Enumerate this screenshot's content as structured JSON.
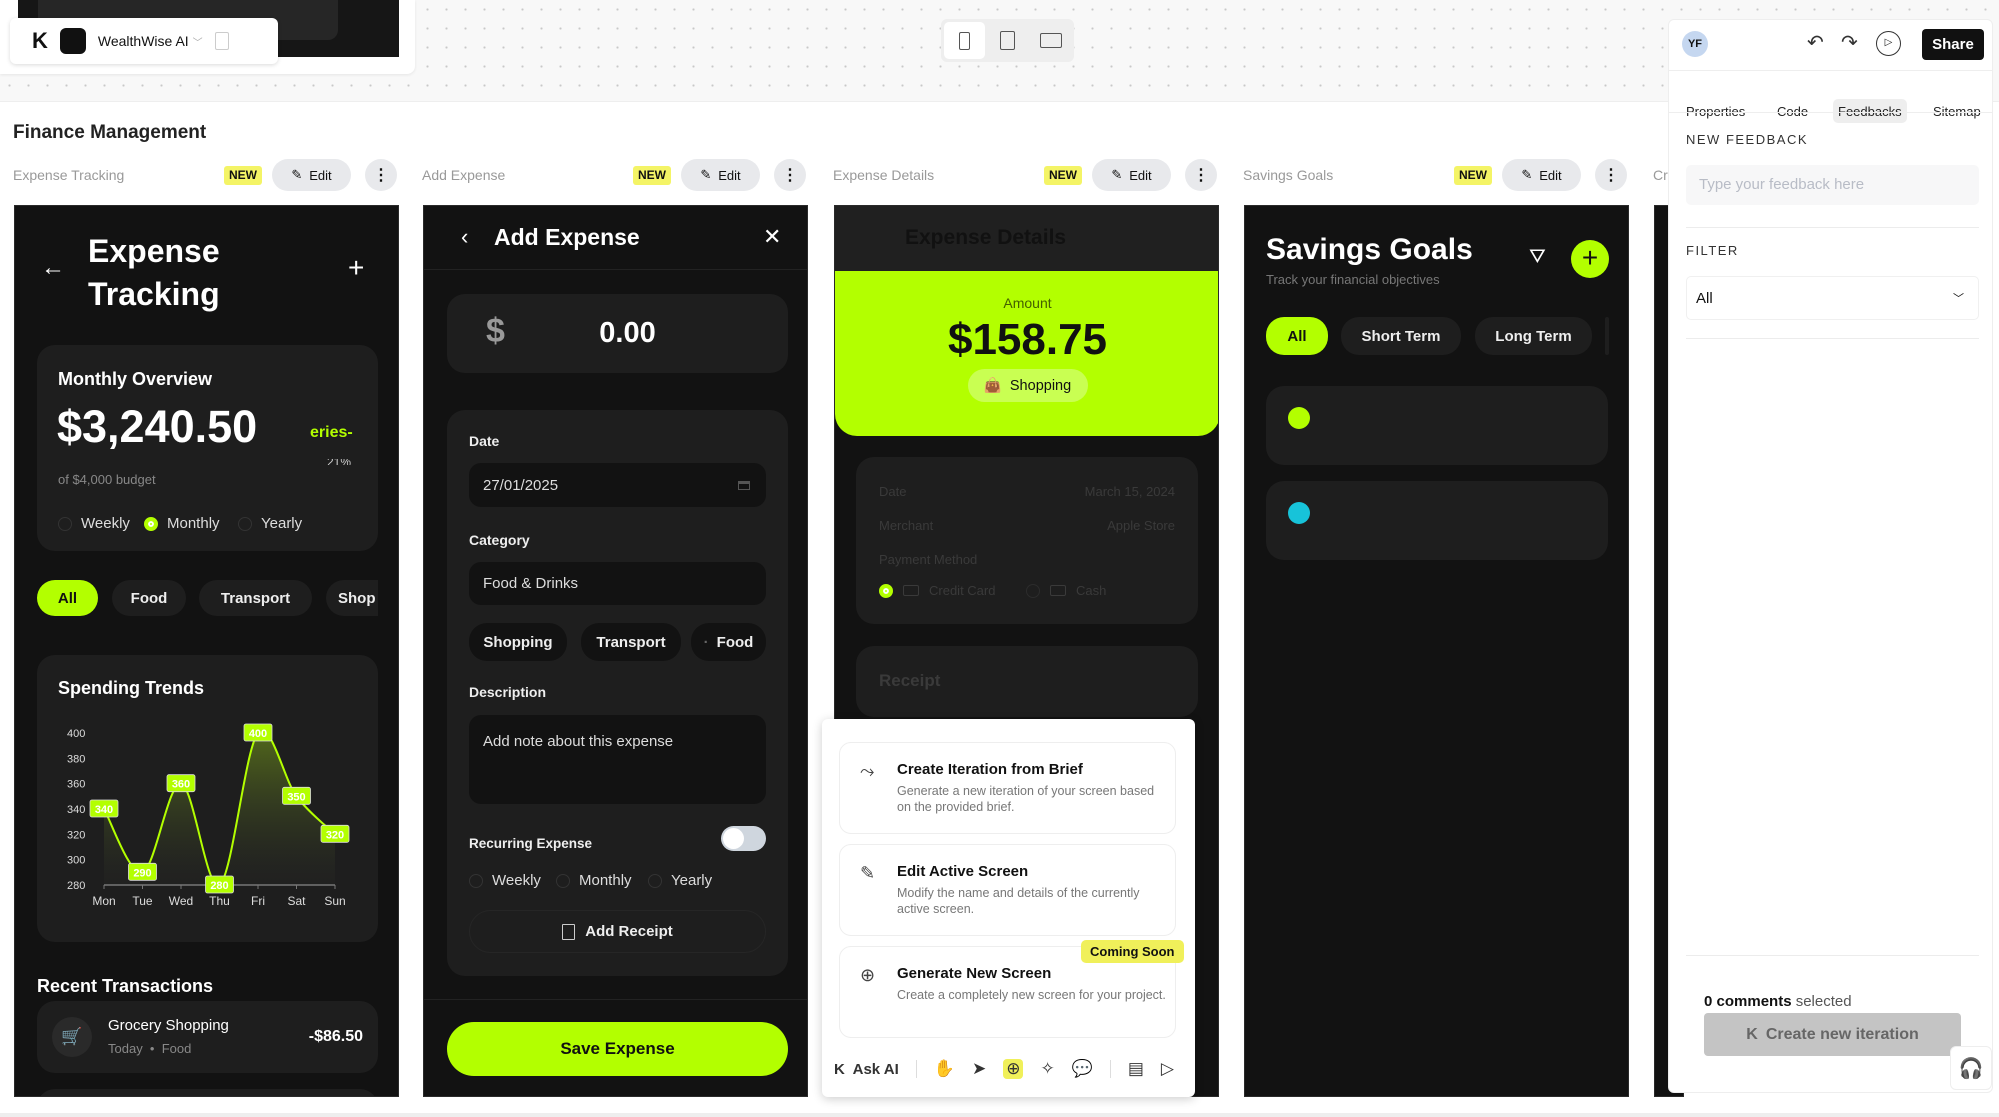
{
  "toolbar": {
    "project_name": "WealthWise AI",
    "share_label": "Share",
    "avatar_initials": "YF"
  },
  "device_switcher": [
    "mobile",
    "tablet",
    "desktop"
  ],
  "canvas": {
    "title": "Finance Management"
  },
  "screens": [
    {
      "label": "Expense Tracking",
      "badge": "NEW",
      "edit": "Edit"
    },
    {
      "label": "Add Expense",
      "badge": "NEW",
      "edit": "Edit"
    },
    {
      "label": "Expense Details",
      "badge": "NEW",
      "edit": "Edit"
    },
    {
      "label": "Savings Goals",
      "badge": "NEW",
      "edit": "Edit"
    },
    {
      "label": "Cr"
    }
  ],
  "expense_tracking": {
    "title_line1": "Expense",
    "title_line2": "Tracking",
    "overview": {
      "title": "Monthly Overview",
      "amount": "$3,240.50",
      "clipped_label": "eries-",
      "clipped_percent": "21%",
      "budget": "of $4,000 budget",
      "periods": [
        {
          "label": "Weekly",
          "selected": false
        },
        {
          "label": "Monthly",
          "selected": true
        },
        {
          "label": "Yearly",
          "selected": false
        }
      ]
    },
    "chips": [
      {
        "label": "All",
        "active": true
      },
      {
        "label": "Food"
      },
      {
        "label": "Transport"
      },
      {
        "label": "Shop"
      }
    ],
    "trends_title": "Spending Trends",
    "recent_title": "Recent Transactions",
    "transaction": {
      "name": "Grocery Shopping",
      "date": "Today",
      "category": "Food",
      "amount": "-$86.50"
    }
  },
  "chart_data": {
    "type": "area",
    "title": "Spending Trends",
    "categories": [
      "Mon",
      "Tue",
      "Wed",
      "Thu",
      "Fri",
      "Sat",
      "Sun"
    ],
    "values": [
      340,
      290,
      360,
      280,
      400,
      350,
      320
    ],
    "ylim": [
      280,
      400
    ],
    "yticks": [
      280,
      300,
      320,
      340,
      360,
      380,
      400
    ],
    "data_labels": true,
    "grid": false,
    "color": "#b3ff00"
  },
  "add_expense": {
    "title": "Add Expense",
    "currency": "$",
    "amount": "0.00",
    "date_label": "Date",
    "date_value": "27/01/2025",
    "category_label": "Category",
    "category_value": "Food & Drinks",
    "chips": [
      "Shopping",
      "Transport",
      "Food"
    ],
    "description_label": "Description",
    "description_placeholder": "Add note about this expense",
    "recurring_label": "Recurring Expense",
    "recurring_on": false,
    "periods": [
      "Weekly",
      "Monthly",
      "Yearly"
    ],
    "receipt_button": "Add Receipt",
    "save_button": "Save Expense"
  },
  "expense_details": {
    "title": "Expense Details",
    "amount_label": "Amount",
    "amount": "$158.75",
    "category": "Shopping",
    "rows": [
      {
        "label": "Date",
        "value": "March 15, 2024"
      },
      {
        "label": "Merchant",
        "value": "Apple Store"
      }
    ],
    "payment_label": "Payment Method",
    "payment_options": [
      {
        "label": "Credit Card",
        "selected": true
      },
      {
        "label": "Cash",
        "selected": false
      }
    ],
    "receipt_title": "Receipt"
  },
  "ai_menu": {
    "items": [
      {
        "title": "Create Iteration from Brief",
        "desc": "Generate a new iteration of your screen based on the provided brief."
      },
      {
        "title": "Edit Active Screen",
        "desc": "Modify the name and details of the currently active screen."
      },
      {
        "title": "Generate New Screen",
        "desc": "Create a completely new screen for your project.",
        "badge": "Coming Soon"
      }
    ],
    "ask_ai": "Ask AI"
  },
  "savings_goals": {
    "title": "Savings Goals",
    "subtitle": "Track your financial objectives",
    "chips": [
      {
        "label": "All",
        "active": true
      },
      {
        "label": "Short Term"
      },
      {
        "label": "Long Term"
      }
    ],
    "goal_colors": [
      "#b3ff00",
      "#17c3d9"
    ]
  },
  "right_panel": {
    "tabs": [
      {
        "label": "Properties"
      },
      {
        "label": "Code"
      },
      {
        "label": "Feedbacks",
        "active": true
      },
      {
        "label": "Sitemap"
      }
    ],
    "new_feedback_label": "NEW FEEDBACK",
    "feedback_placeholder": "Type your feedback here",
    "filter_label": "FILTER",
    "filter_value": "All",
    "comments_count": "0 comments",
    "comments_suffix": "selected",
    "create_button": "Create new iteration"
  },
  "colors": {
    "accent": "#b3ff00",
    "frame_bg": "#121212",
    "card_bg": "#1e1e1e",
    "badge_yellow": "#f4f466"
  }
}
